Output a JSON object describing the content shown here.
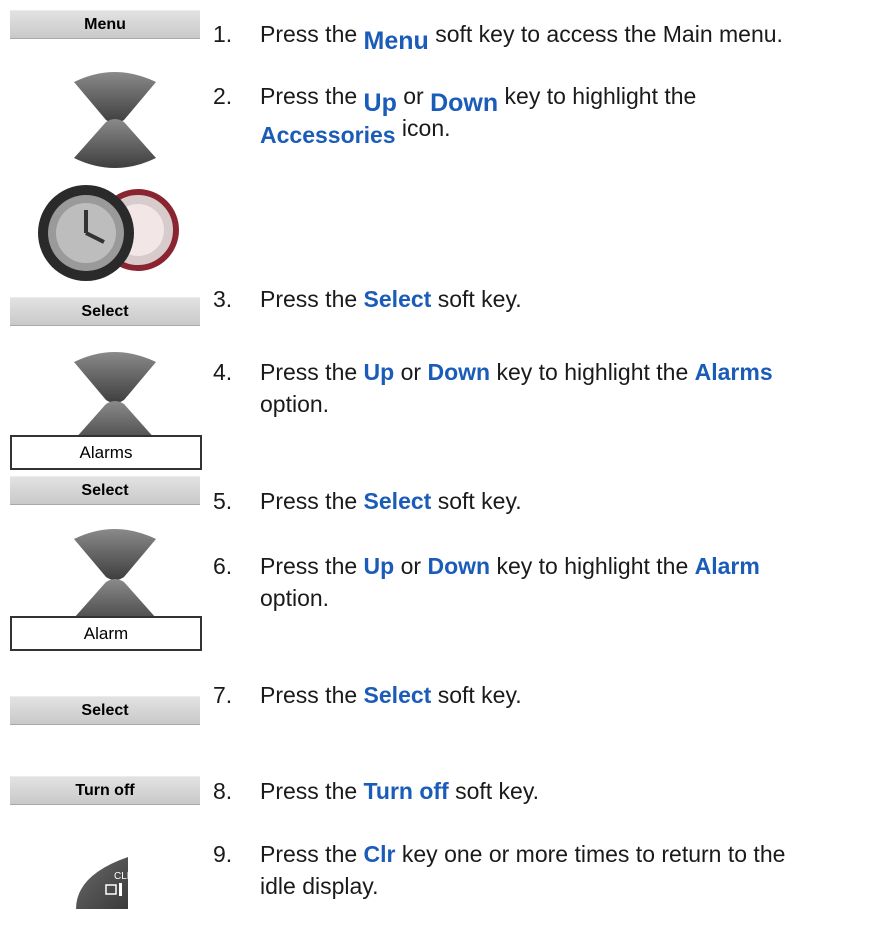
{
  "softkeys": {
    "menu": "Menu",
    "select1": "Select",
    "select2": "Select",
    "select3": "Select",
    "turnoff": "Turn off"
  },
  "options": {
    "alarms": "Alarms",
    "alarm": "Alarm"
  },
  "icons": {
    "nav_up": "up-navigation-key-icon",
    "nav_down": "down-navigation-key-icon",
    "accessories": "accessories-clock-icon",
    "clr": "clr-key-icon",
    "clr_label": "CLR"
  },
  "colors": {
    "keyword": "#1b5cb8",
    "text": "#1a1a1a"
  },
  "steps": [
    {
      "num": "1.",
      "pre": "Press the ",
      "key": "Menu",
      "post": " soft key to access the Main menu."
    },
    {
      "num": "2.",
      "pre": "Press the ",
      "key": "Up",
      "mid": " or ",
      "key2": "Down",
      "post": " key to highlight the",
      "key3": "Accessories",
      "post2": " icon."
    },
    {
      "num": "3.",
      "pre": "Press the ",
      "key": "Select",
      "post": " soft key."
    },
    {
      "num": "4.",
      "pre": "Press the ",
      "key": "Up",
      "mid": " or ",
      "key2": "Down",
      "post": " key to highlight the ",
      "key3": "Alarms",
      "post2": "option."
    },
    {
      "num": "5.",
      "pre": "Press the ",
      "key": "Select",
      "post": " soft key."
    },
    {
      "num": "6.",
      "pre": "Press the ",
      "key": "Up",
      "mid": " or ",
      "key2": "Down",
      "post": " key to highlight the ",
      "key3": "Alarm",
      "post2": "option."
    },
    {
      "num": "7.",
      "pre": "Press the ",
      "key": "Select",
      "post": " soft key."
    },
    {
      "num": "8.",
      "pre": "Press the ",
      "key": "Turn off",
      "post": " soft key."
    },
    {
      "num": "9.",
      "pre": "Press the ",
      "key": "Clr",
      "post": " key one or more times to return to the",
      "post2": "idle display."
    }
  ]
}
